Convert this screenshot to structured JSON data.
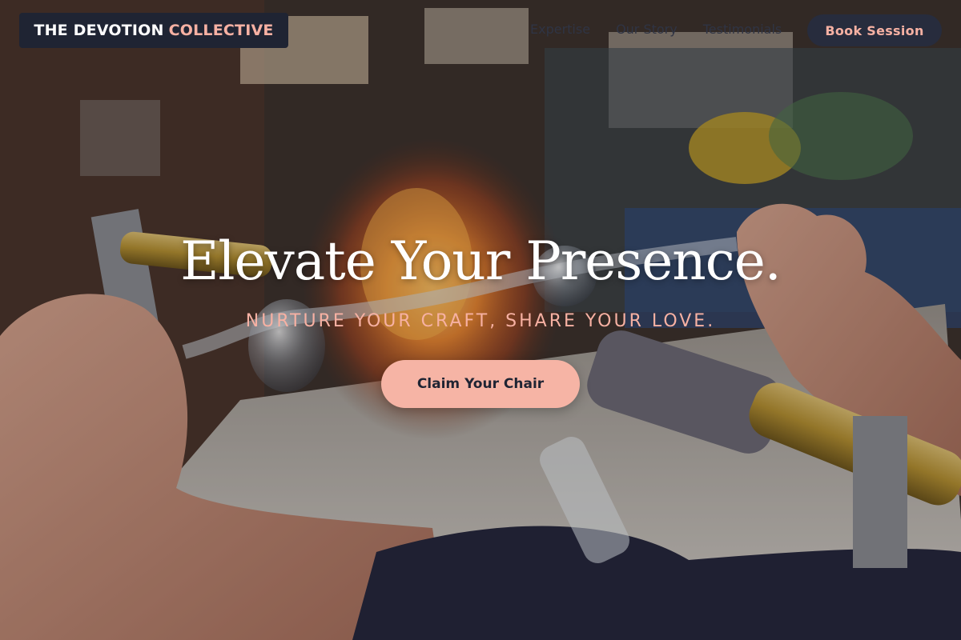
{
  "brand": {
    "name_primary": "THE DEVOTION",
    "name_accent": "COLLECTIVE"
  },
  "nav": {
    "links": [
      "Expertise",
      "Our Story",
      "Testimonials"
    ],
    "book_label": "Book Session"
  },
  "hero": {
    "headline": "Elevate Your Presence.",
    "tagline": "NURTURE YOUR CRAFT, SHARE YOUR LOVE.",
    "cta_label": "Claim Your Chair",
    "background_image": "glassblowing-workbench-photo"
  },
  "colors": {
    "brand_bg": "#1f2433",
    "accent": "#f7b1a3",
    "cta_bg": "#f6b4a5",
    "text_light": "#ffffff"
  }
}
